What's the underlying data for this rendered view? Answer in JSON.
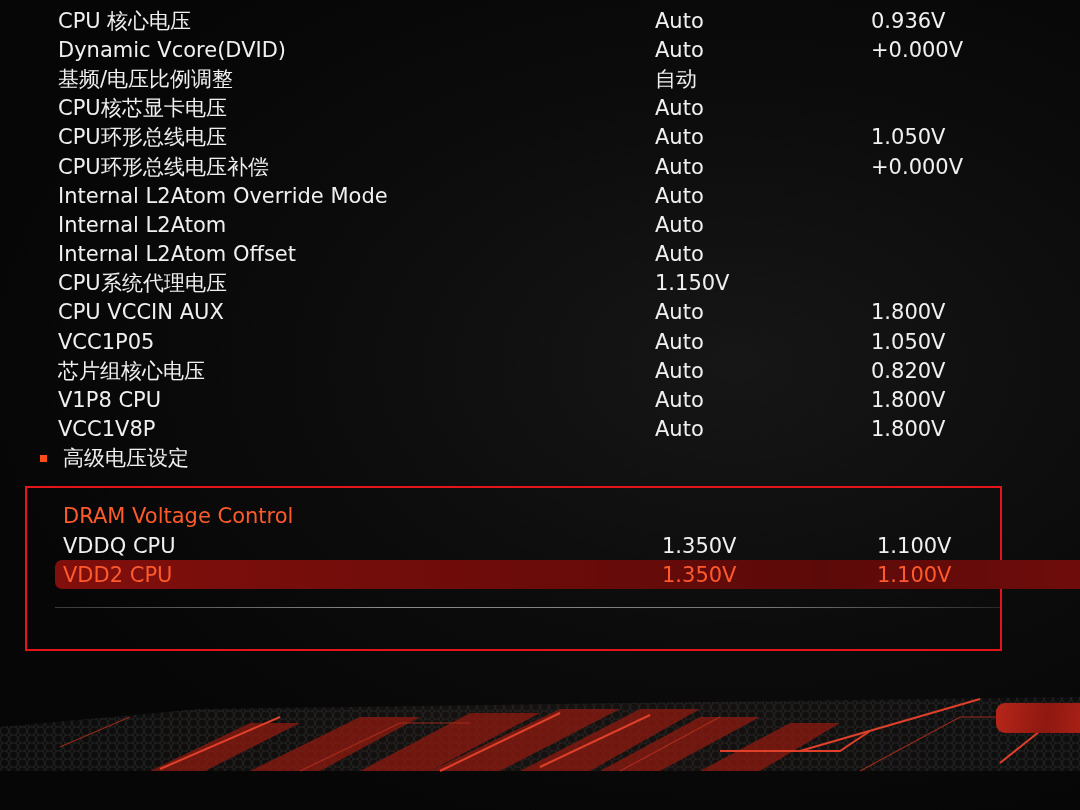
{
  "settings": [
    {
      "kind": "setting",
      "label": "CPU 核心电压",
      "value": "Auto",
      "reading": "0.936V",
      "selected": false
    },
    {
      "kind": "setting",
      "label": "Dynamic Vcore(DVID)",
      "value": "Auto",
      "reading": "+0.000V",
      "selected": false
    },
    {
      "kind": "setting",
      "label": "基频/电压比例调整",
      "value": "自动",
      "selected": false
    },
    {
      "kind": "setting",
      "label": "CPU核芯显卡电压",
      "value": "Auto",
      "selected": false
    },
    {
      "kind": "setting",
      "label": "CPU环形总线电压",
      "value": "Auto",
      "reading": "1.050V",
      "selected": false
    },
    {
      "kind": "setting",
      "label": "CPU环形总线电压补偿",
      "value": "Auto",
      "reading": "+0.000V",
      "selected": false
    },
    {
      "kind": "setting",
      "label": "Internal L2Atom Override Mode",
      "value": "Auto",
      "selected": false
    },
    {
      "kind": "setting",
      "label": "Internal L2Atom",
      "value": "Auto",
      "selected": false
    },
    {
      "kind": "setting",
      "label": "Internal L2Atom Offset",
      "value": "Auto",
      "selected": false
    },
    {
      "kind": "setting",
      "label": "CPU系统代理电压",
      "value": "1.150V",
      "selected": false
    },
    {
      "kind": "setting",
      "label": "CPU VCCIN AUX",
      "value": "Auto",
      "reading": "1.800V",
      "selected": false
    },
    {
      "kind": "setting",
      "label": "VCC1P05",
      "value": "Auto",
      "reading": "1.050V",
      "selected": false
    },
    {
      "kind": "setting",
      "label": "芯片组核心电压",
      "value": "Auto",
      "reading": "0.820V",
      "selected": false
    },
    {
      "kind": "setting",
      "label": "V1P8 CPU",
      "value": "Auto",
      "reading": "1.800V",
      "selected": false
    },
    {
      "kind": "setting",
      "label": "VCC1V8P",
      "value": "Auto",
      "reading": "1.800V",
      "selected": false
    },
    {
      "kind": "submenu",
      "label": "高级电压设定",
      "selected": false
    }
  ],
  "dram_voltage_control": {
    "title": "DRAM Voltage Control",
    "settings": [
      {
        "kind": "setting",
        "label": "VDDQ CPU",
        "value": "1.350V",
        "reading": "1.100V",
        "selected": false
      },
      {
        "kind": "setting",
        "label": "VDD2 CPU",
        "value": "1.350V",
        "reading": "1.100V",
        "selected": true
      }
    ]
  }
}
